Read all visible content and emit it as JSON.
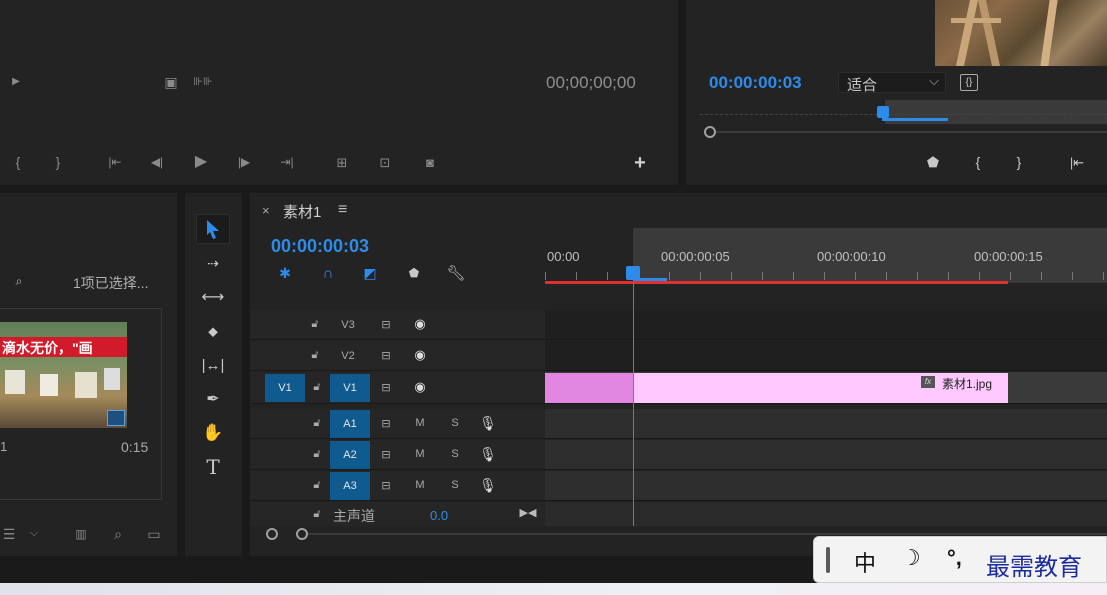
{
  "source_monitor": {
    "timecode": "00;00;00;00"
  },
  "program_monitor": {
    "timecode": "00:00:00:03",
    "fit_select": "适合",
    "fit_caret": "⌵"
  },
  "project_panel": {
    "selection_count": "1项已选择...",
    "clip_duration": "0:15",
    "clip_left_number": "1",
    "clip_banner_text": "滴水无价，\"画"
  },
  "timeline": {
    "sequence_name": "素材1",
    "close_glyph": "×",
    "menu_glyph": "≡",
    "timecode": "00:00:00:03",
    "ruler": [
      "00:00",
      "00:00:00:05",
      "00:00:00:10",
      "00:00:00:15"
    ],
    "tracks": {
      "v3": "V3",
      "v2": "V2",
      "v1": "V1",
      "v1_source": "V1",
      "a1": "A1",
      "a2": "A2",
      "a3": "A3",
      "mute": "M",
      "solo": "S",
      "master_label": "主声道",
      "master_value": "0.0"
    },
    "clip_label": "素材1.jpg",
    "fx_badge": "fx"
  },
  "ime_bar": {
    "lang": "中",
    "punct": "°,",
    "brand": "最需教育"
  },
  "colors": {
    "accent": "#2d8ceb",
    "clip_pink": "#ffc8ff",
    "clip_pink_dark": "#e186e1",
    "track_target": "#0f5a8e",
    "work_area": "#e03030"
  }
}
